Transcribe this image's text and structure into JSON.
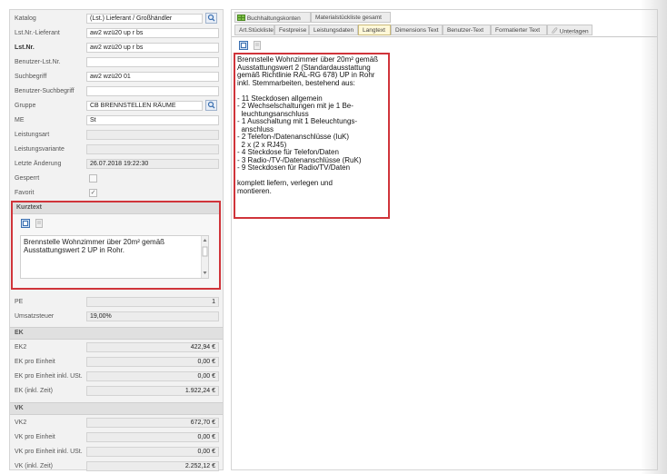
{
  "form": {
    "rows": [
      {
        "label": "Katalog",
        "value": "(Lst.) Lieferant / Großhändler",
        "lookup": true
      },
      {
        "label": "Lst.Nr.-Lieferant",
        "value": "aw2 wzü20 up r bs"
      },
      {
        "label": "Lst.Nr.",
        "value": "aw2 wzü20 up r bs",
        "bold": true
      },
      {
        "label": "Benutzer-Lst.Nr.",
        "value": ""
      },
      {
        "label": "Suchbegriff",
        "value": "aw2 wzü20 01"
      },
      {
        "label": "Benutzer-Suchbegriff",
        "value": ""
      },
      {
        "label": "Gruppe",
        "value": "CB BRENNSTELLEN RÄUME",
        "lookup": true
      },
      {
        "label": "ME",
        "value": "St"
      },
      {
        "label": "Leistungsart",
        "value": ""
      },
      {
        "label": "Leistungsvariante",
        "value": ""
      },
      {
        "label": "Letzte Änderung",
        "value": "26.07.2018 19:22:30"
      },
      {
        "label": "Gesperrt",
        "checkbox": ""
      },
      {
        "label": "Favorit",
        "checkbox": "✓"
      }
    ]
  },
  "kurztext": {
    "title": "Kurztext",
    "text": "Brennstelle Wohnzimmer über 20m² gemäß Ausstattungswert 2 UP in Rohr."
  },
  "misc": [
    {
      "label": "PE",
      "value": "1"
    },
    {
      "label": "Umsatzsteuer",
      "value": "19,00%"
    }
  ],
  "ek": {
    "title": "EK",
    "rows": [
      {
        "label": "EK2",
        "value": "422,94 €"
      },
      {
        "label": "EK pro Einheit",
        "value": "0,00 €"
      },
      {
        "label": "EK pro Einheit inkl. USt.",
        "value": "0,00 €"
      },
      {
        "label": "EK (inkl. Zeit)",
        "value": "1.922,24 €"
      }
    ]
  },
  "vk": {
    "title": "VK",
    "rows": [
      {
        "label": "VK2",
        "value": "672,70 €"
      },
      {
        "label": "VK pro Einheit",
        "value": "0,00 €"
      },
      {
        "label": "VK pro Einheit inkl. USt.",
        "value": "0,00 €"
      },
      {
        "label": "VK (inkl. Zeit)",
        "value": "2.252,12 €"
      }
    ]
  },
  "tabs_top": [
    "Buchhaltungskonten",
    "Materialstückliste gesamt"
  ],
  "tabs_main": [
    "Art.Stückliste",
    "Festpreise",
    "Leistungsdaten",
    "Langtext",
    "Dimensions Text",
    "Benutzer-Text",
    "Formatierter Text",
    "Unterlagen"
  ],
  "active_tab": "Langtext",
  "langtext": "Brennstelle Wohnzimmer über 20m² gemäß\nAusstattungswert 2 (Standardausstattung\ngemäß Richtlinie RAL-RG 678) UP in Rohr\ninkl. Stemmarbeiten, bestehend aus:\n\n- 11 Steckdosen allgemein\n- 2 Wechselschaltungen mit je 1 Be-\n  leuchtungsanschluss\n- 1 Ausschaltung mit 1 Beleuchtungs-\n  anschluss\n- 2 Telefon-/Datenanschlüsse (IuK)\n  2 x (2 x RJ45)\n- 4 Steckdose für Telefon/Daten\n- 3 Radio-/TV-/Datenanschlüsse (RuK)\n- 9 Steckdosen für Radio/TV/Daten\n\nkomplett liefern, verlegen und\nmontieren.",
  "colors": {
    "highlight": "#d0343a",
    "active_tab": "#fff8d8"
  }
}
